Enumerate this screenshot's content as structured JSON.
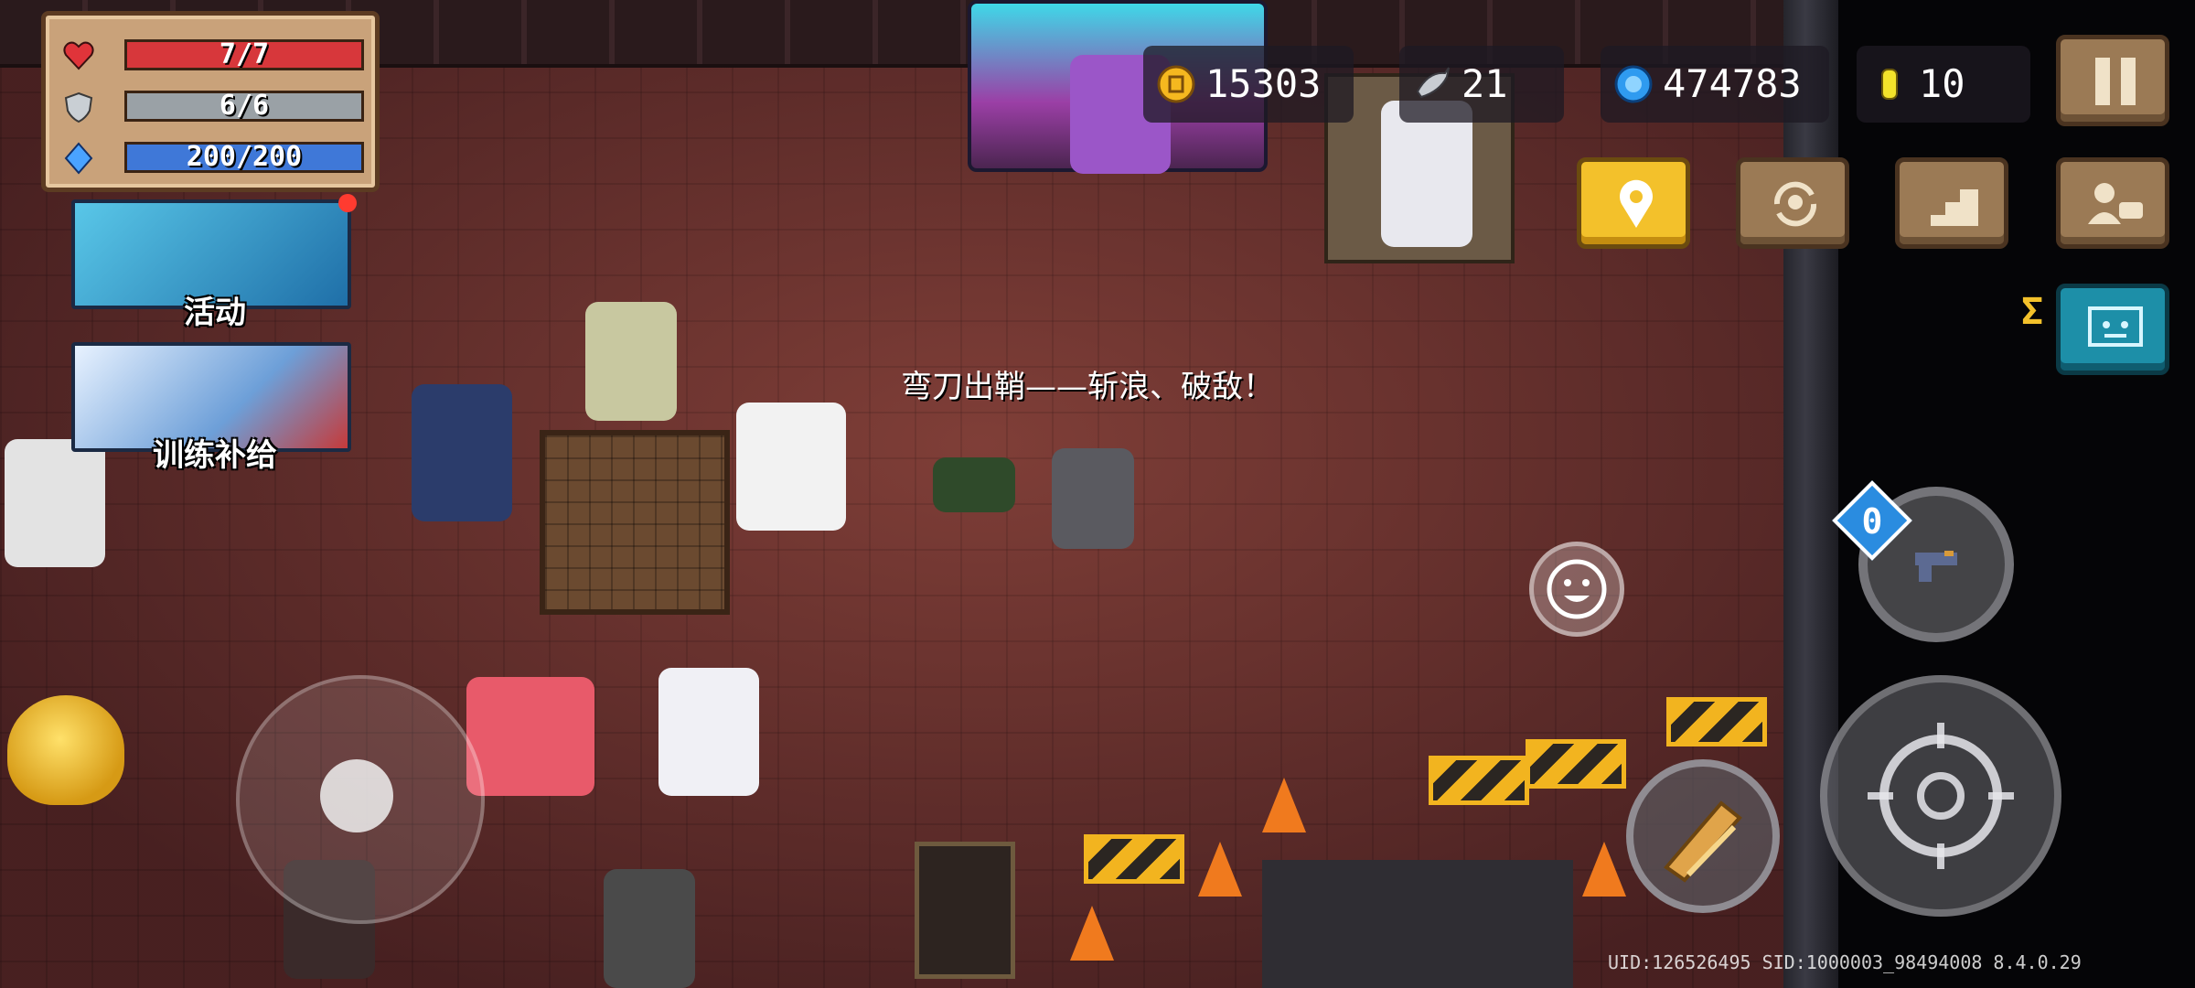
{
  "stats": {
    "hp": {
      "text": "7/7",
      "color": "#d7373b"
    },
    "armor": {
      "text": "6/6",
      "color": "#9aa1a6"
    },
    "energy": {
      "text": "200/200",
      "color": "#3f78d8"
    }
  },
  "banners": {
    "event_label": "活动",
    "training_label": "训练补给"
  },
  "currency": {
    "gold": "15303",
    "fish": "21",
    "gems": "474783",
    "tokens": "10"
  },
  "dialogue": "弯刀出鞘——斩浪、破敌！",
  "weapon_slot_count": "0",
  "version_text": "UID:126526495 SID:1000003_98494008 8.4.0.29",
  "icons": {
    "hp": "heart-icon",
    "armor": "shield-icon",
    "energy": "energy-crystal-icon",
    "gold": "gold-coin-icon",
    "fish": "fish-icon",
    "gems": "gem-icon",
    "tokens": "token-icon",
    "pause": "pause-icon",
    "location": "location-pin-icon",
    "switch": "character-switch-icon",
    "stairs": "stairs-icon",
    "profile": "profile-card-icon",
    "chat": "chat-icon",
    "emote": "smiley-icon",
    "attack": "crosshair-icon",
    "skill": "weapon-skill-icon"
  }
}
